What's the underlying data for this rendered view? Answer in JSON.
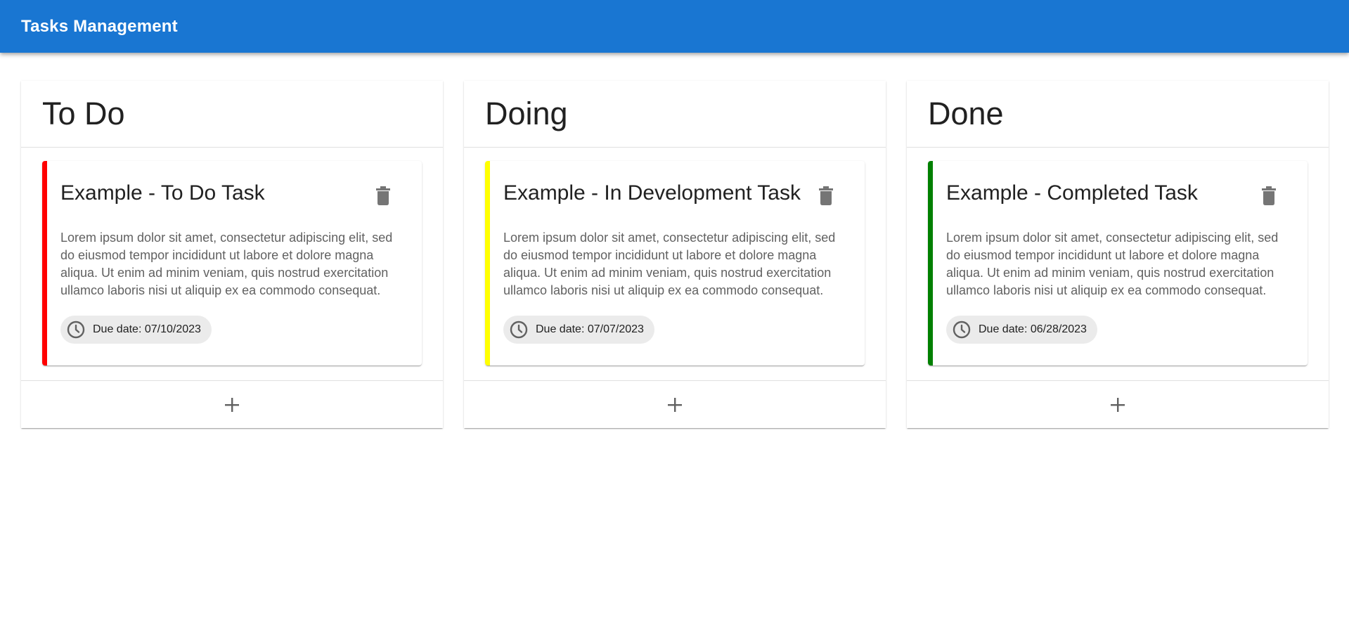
{
  "app": {
    "title": "Tasks Management"
  },
  "columns": [
    {
      "title": "To Do",
      "accent": "#ff0000",
      "task": {
        "title": "Example - To Do Task",
        "description": "Lorem ipsum dolor sit amet, consectetur adipiscing elit, sed do eiusmod tempor incididunt ut labore et dolore magna aliqua. Ut enim ad minim veniam, quis nostrud exercitation ullamco laboris nisi ut aliquip ex ea commodo consequat.",
        "due": "Due date: 07/10/2023"
      }
    },
    {
      "title": "Doing",
      "accent": "#ffff00",
      "task": {
        "title": "Example - In Development Task",
        "description": "Lorem ipsum dolor sit amet, consectetur adipiscing elit, sed do eiusmod tempor incididunt ut labore et dolore magna aliqua. Ut enim ad minim veniam, quis nostrud exercitation ullamco laboris nisi ut aliquip ex ea commodo consequat.",
        "due": "Due date: 07/07/2023"
      }
    },
    {
      "title": "Done",
      "accent": "#008000",
      "task": {
        "title": "Example - Completed Task",
        "description": "Lorem ipsum dolor sit amet, consectetur adipiscing elit, sed do eiusmod tempor incididunt ut labore et dolore magna aliqua. Ut enim ad minim veniam, quis nostrud exercitation ullamco laboris nisi ut aliquip ex ea commodo consequat.",
        "due": "Due date: 06/28/2023"
      }
    }
  ],
  "icons": {
    "delete": "trash-icon",
    "due": "clock-icon",
    "add": "plus-icon"
  },
  "colors": {
    "app_bar": "#1976d2",
    "icon_gray": "#757575"
  }
}
